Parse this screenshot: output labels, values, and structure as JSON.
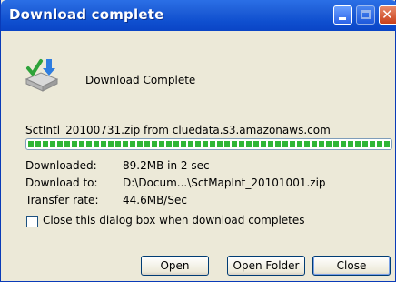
{
  "window": {
    "title": "Download complete"
  },
  "header": {
    "message": "Download Complete"
  },
  "download": {
    "source": "SctIntl_20100731.zip from cluedata.s3.amazonaws.com",
    "progress_fraction": 1.0,
    "rows": [
      {
        "label": "Downloaded:",
        "value": "89.2MB in 2 sec"
      },
      {
        "label": "Download to:",
        "value": "D:\\Docum...\\SctMapInt_20101001.zip"
      },
      {
        "label": "Transfer rate:",
        "value": "44.6MB/Sec"
      }
    ]
  },
  "options": {
    "close_when_done_label": "Close this dialog box when download completes",
    "close_when_done_checked": false
  },
  "buttons": {
    "open": "Open",
    "open_folder": "Open Folder",
    "close": "Close"
  },
  "colors": {
    "title_bar": "#1f5fd8",
    "progress": "#2fb535",
    "dialog_bg": "#ece9d8"
  },
  "icons": {
    "download": "download-complete-icon",
    "close": "close-icon",
    "minimize": "minimize-icon",
    "maximize": "maximize-icon"
  }
}
